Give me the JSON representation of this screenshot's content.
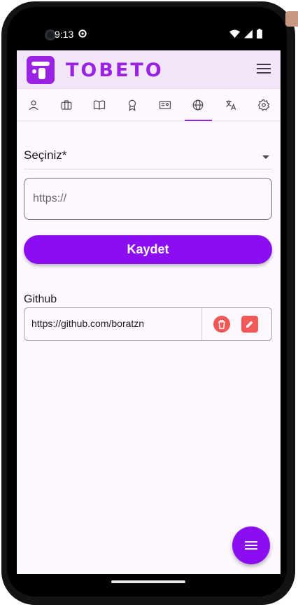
{
  "status": {
    "time": "9:13"
  },
  "app": {
    "logo_text": "TOBETO",
    "brand_color": "#8a0ef0"
  },
  "tabs": [
    {
      "icon": "person-icon"
    },
    {
      "icon": "briefcase-icon"
    },
    {
      "icon": "book-icon"
    },
    {
      "icon": "award-icon"
    },
    {
      "icon": "certificate-icon"
    },
    {
      "icon": "globe-icon",
      "active": true
    },
    {
      "icon": "translate-icon"
    },
    {
      "icon": "settings-icon"
    }
  ],
  "form": {
    "select_label": "Seçiniz*",
    "url_placeholder": "https://",
    "save_label": "Kaydet"
  },
  "social_links": [
    {
      "platform": "Github",
      "url": "https://github.com/boratzn"
    }
  ]
}
